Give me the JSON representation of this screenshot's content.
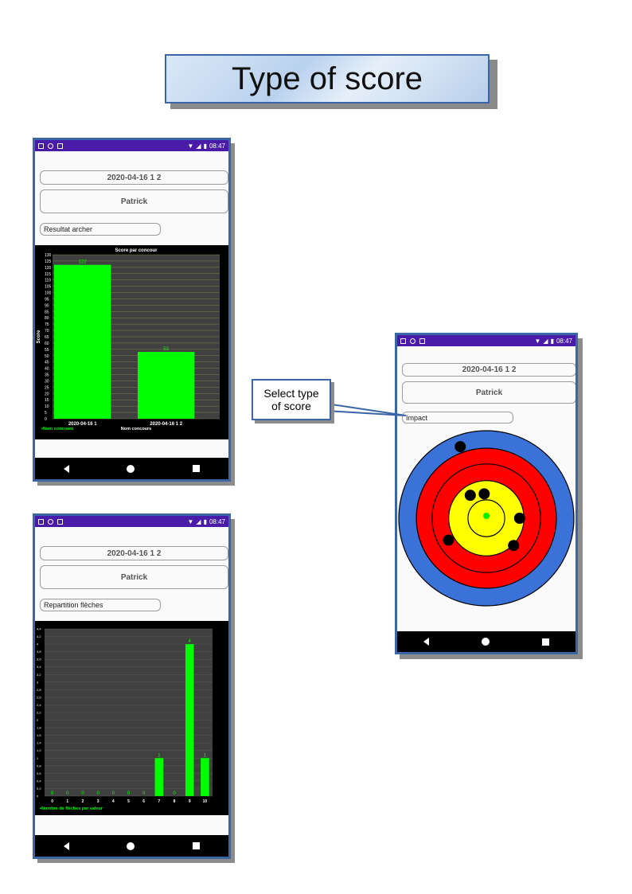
{
  "title": "Type of score",
  "callout": {
    "line1": "Select type",
    "line2": "of score"
  },
  "status": {
    "time": "08:47"
  },
  "header": {
    "session": "2020-04-16 1 2",
    "archer": "Patrick"
  },
  "phone1": {
    "spinner": "Resultat archer",
    "chart_data": {
      "type": "bar",
      "title": "Score par concour",
      "ylabel": "Score",
      "xlabel": "Nom concours",
      "legend": "Nom concours",
      "categories": [
        "2020-04-16 1",
        "2020-04-16 1 2"
      ],
      "values": [
        122,
        53
      ],
      "ylim": [
        0,
        130
      ],
      "ytick_step": 5,
      "bar_color": "#00ff00",
      "background": "#404040"
    }
  },
  "phone2": {
    "spinner": "Repartition flèches",
    "chart_data": {
      "type": "bar",
      "title": "",
      "legend": "Nombre de flèches par valeur",
      "categories": [
        "0",
        "1",
        "2",
        "3",
        "4",
        "5",
        "6",
        "7",
        "8",
        "9",
        "10"
      ],
      "values": [
        0,
        0,
        0,
        0,
        0,
        0,
        0,
        1,
        0,
        4,
        1
      ],
      "ylim": [
        0,
        4.4
      ],
      "yticks": [
        "0",
        "0,2",
        "0,4",
        "0,6",
        "0,8",
        "1",
        "1,2",
        "1,4",
        "1,6",
        "1,8",
        "2",
        "2,2",
        "2,4",
        "2,6",
        "2,8",
        "3",
        "3,2",
        "3,4",
        "3,6",
        "3,8",
        "4",
        "4,2",
        "4,4"
      ],
      "bar_color": "#00ff00",
      "background": "#404040"
    }
  },
  "phone3": {
    "spinner": "Impact",
    "target": {
      "rings": [
        "#3a72d8",
        "#ff0000",
        "#ffff00"
      ],
      "impact_count": 7,
      "impacts": [
        {
          "r": 0.87,
          "a": 110
        },
        {
          "r": 0.28,
          "a": 95
        },
        {
          "r": 0.38,
          "a": 0
        },
        {
          "r": 0.44,
          "a": 315
        },
        {
          "r": 0.5,
          "a": 210
        },
        {
          "r": 0.32,
          "a": 125
        }
      ]
    }
  }
}
